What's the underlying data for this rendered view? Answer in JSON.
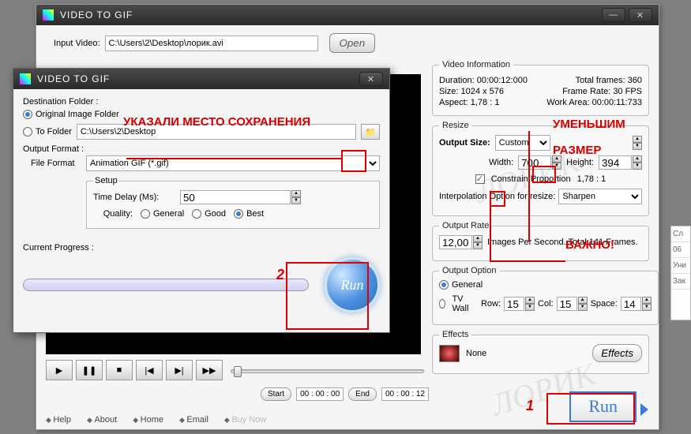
{
  "main": {
    "title": "VIDEO TO GIF",
    "input_label": "Input Video:",
    "input_value": "C:\\Users\\2\\Desktop\\лорик.avi",
    "open_label": "Open",
    "start_label": "Start",
    "end_label": "End",
    "start_time": "00 : 00 : 00",
    "end_time": "00 : 00 : 12",
    "links": [
      "Help",
      "About",
      "Home",
      "Email",
      "Buy Now"
    ],
    "run_label": "Run"
  },
  "info": {
    "legend": "Video Information",
    "duration_k": "Duration:",
    "duration_v": "00:00:12:000",
    "frames_k": "Total frames:",
    "frames_v": "360",
    "size_k": "Size:",
    "size_v": "1024 x 576",
    "fps_k": "Frame Rate:",
    "fps_v": "30 FPS",
    "aspect_k": "Aspect:",
    "aspect_v": "1,78 : 1",
    "work_k": "Work Area:",
    "work_v": "00:00:11:733"
  },
  "resize": {
    "legend": "Resize",
    "outsize_label": "Output Size:",
    "outsize_value": "Custom",
    "width_label": "Width:",
    "width_value": "700",
    "height_label": "Height:",
    "height_value": "394",
    "constrain_label": "Constrain Proportion",
    "constrain_ratio": "1,78 : 1",
    "interp_label": "Interpolation Option for resize:",
    "interp_value": "Sharpen"
  },
  "rate": {
    "legend": "Output Rate",
    "value": "12,00",
    "suffix": "Images Per Second. Total:141 Frames."
  },
  "outopt": {
    "legend": "Output Option",
    "general": "General",
    "tvwall": "TV Wall",
    "row_l": "Row:",
    "row_v": "15",
    "col_l": "Col:",
    "col_v": "15",
    "space_l": "Space:",
    "space_v": "14"
  },
  "effects": {
    "legend": "Effects",
    "name": "None",
    "btn": "Effects"
  },
  "dialog": {
    "title": "VIDEO TO GIF",
    "dest_label": "Destination Folder :",
    "opt_original": "Original Image Folder",
    "opt_tofolder": "To Folder",
    "folder_value": "C:\\Users\\2\\Desktop",
    "outfmt_label": "Output Format :",
    "filefmt_label": "File Format",
    "filefmt_value": "Animation GIF (*.gif)",
    "setup_label": "Setup",
    "delay_label": "Time Delay (Ms):",
    "delay_value": "50",
    "quality_label": "Quality:",
    "q_general": "General",
    "q_good": "Good",
    "q_best": "Best",
    "progress_label": "Current Progress :",
    "run_label": "Run"
  },
  "annotations": {
    "save": "УКАЗАЛИ МЕСТО СОХРАНЕНИЯ",
    "shrink1": "УМЕНЬШИМ",
    "shrink2": "РАЗМЕР",
    "important": "ВАЖНО!",
    "n1": "1",
    "n2": "2"
  },
  "side": {
    "a": "Сл",
    "b": "06",
    "c": "Уни",
    "d": "Зак"
  }
}
